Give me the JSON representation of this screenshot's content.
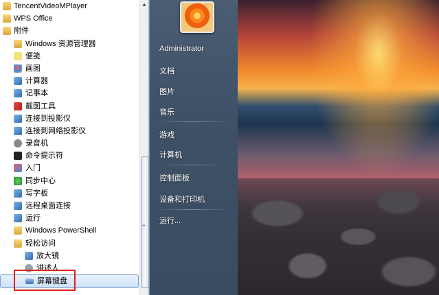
{
  "start_menu": {
    "programs": [
      {
        "label": "TencentVideoMPlayer",
        "level": 0,
        "icon": "folder-icon"
      },
      {
        "label": "WPS Office",
        "level": 0,
        "icon": "folder-icon"
      },
      {
        "label": "附件",
        "level": 0,
        "icon": "folder-icon"
      },
      {
        "label": "Windows 资源管理器",
        "level": 1,
        "icon": "explorer-icon"
      },
      {
        "label": "便笺",
        "level": 1,
        "icon": "sticky-notes-icon"
      },
      {
        "label": "画图",
        "level": 1,
        "icon": "paint-icon"
      },
      {
        "label": "计算器",
        "level": 1,
        "icon": "calculator-icon"
      },
      {
        "label": "记事本",
        "level": 1,
        "icon": "notepad-icon"
      },
      {
        "label": "截图工具",
        "level": 1,
        "icon": "snipping-tool-icon"
      },
      {
        "label": "连接到投影仪",
        "level": 1,
        "icon": "projector-icon"
      },
      {
        "label": "连接到网络投影仪",
        "level": 1,
        "icon": "network-projector-icon"
      },
      {
        "label": "录音机",
        "level": 1,
        "icon": "microphone-icon"
      },
      {
        "label": "命令提示符",
        "level": 1,
        "icon": "cmd-icon"
      },
      {
        "label": "入门",
        "level": 1,
        "icon": "getting-started-icon"
      },
      {
        "label": "同步中心",
        "level": 1,
        "icon": "sync-center-icon"
      },
      {
        "label": "写字板",
        "level": 1,
        "icon": "wordpad-icon"
      },
      {
        "label": "远程桌面连接",
        "level": 1,
        "icon": "remote-desktop-icon"
      },
      {
        "label": "运行",
        "level": 1,
        "icon": "run-icon"
      },
      {
        "label": "Windows PowerShell",
        "level": 1,
        "icon": "folder-icon"
      },
      {
        "label": "轻松访问",
        "level": 1,
        "icon": "folder-icon"
      },
      {
        "label": "放大镜",
        "level": 2,
        "icon": "magnifier-icon"
      },
      {
        "label": "讲述人",
        "level": 2,
        "icon": "narrator-icon"
      },
      {
        "label": "屏幕键盘",
        "level": 2,
        "icon": "keyboard-icon",
        "selected": true
      }
    ],
    "right_pane": {
      "user": "Administrator",
      "items": [
        "文档",
        "图片",
        "音乐",
        "游戏",
        "计算机",
        "控制面板",
        "设备和打印机",
        "运行..."
      ]
    },
    "scrollbar_grip": "≡",
    "scroll_up_arrow": "▲"
  },
  "colors": {
    "highlight_border": "#e0201c",
    "right_pane_bg": "#3e5166"
  }
}
